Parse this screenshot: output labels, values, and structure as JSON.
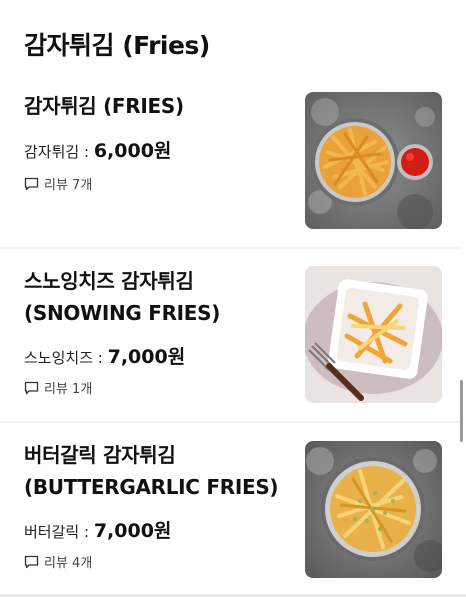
{
  "section": {
    "title": "감자튀김 (Fries)"
  },
  "items": [
    {
      "name_lines": [
        "감자튀김 (FRIES)"
      ],
      "price_label": "감자튀김 :",
      "price": "6,000원",
      "reviews": "리뷰 7개",
      "image_icon": "fries-with-ketchup-image"
    },
    {
      "name_lines": [
        "스노잉치즈 감자튀김",
        "(SNOWING FRIES)"
      ],
      "price_label": "스노잉치즈 :",
      "price": "7,000원",
      "reviews": "리뷰 1개",
      "image_icon": "cheese-fries-plate-image"
    },
    {
      "name_lines": [
        "버터갈릭 감자튀김",
        "(BUTTERGARLIC FRIES)"
      ],
      "price_label": "버터갈릭 :",
      "price": "7,000원",
      "reviews": "리뷰 4개",
      "image_icon": "garlic-fries-bowl-image"
    }
  ],
  "colors": {
    "divider": "#f3f3f3",
    "text": "#111111",
    "scrollbar": "#9a9a9a"
  }
}
